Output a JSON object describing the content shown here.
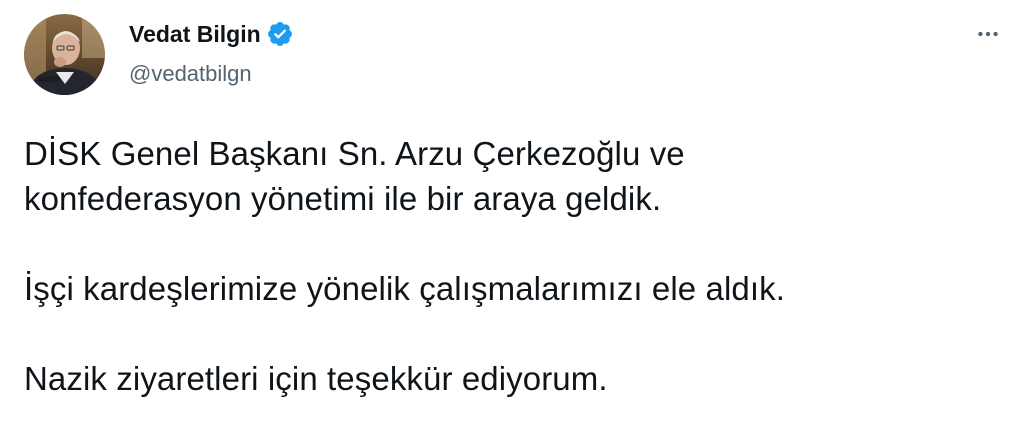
{
  "author": {
    "display_name": "Vedat Bilgin",
    "handle": "@vedatbilgn",
    "verified": true,
    "verified_icon": "verified-badge-icon",
    "verified_color": "#1d9bf0",
    "avatar_icon": "avatar-photo"
  },
  "toolbar": {
    "more_icon": "more-horizontal-icon"
  },
  "tweet": {
    "paragraphs": [
      "DİSK Genel Başkanı Sn. Arzu Çerkezoğlu ve\nkonfederasyon yönetimi ile bir araya geldik.",
      "İşçi kardeşlerimize yönelik çalışmalarımızı ele aldık.",
      "Nazik ziyaretleri için teşekkür ediyorum."
    ]
  },
  "colors": {
    "text_primary": "#0f1419",
    "text_secondary": "#536471",
    "accent": "#1d9bf0",
    "background": "#ffffff"
  }
}
